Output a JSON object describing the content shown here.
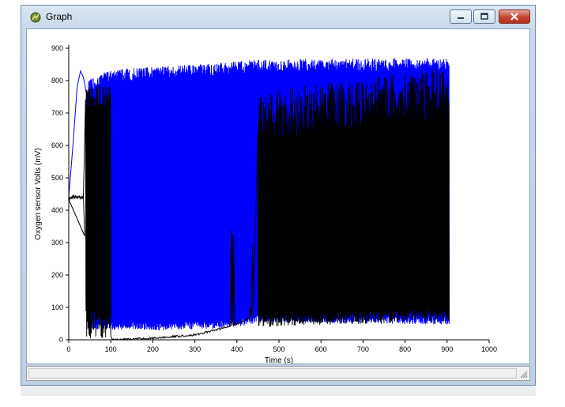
{
  "window": {
    "title": "Graph",
    "icon": "graph-app-icon",
    "controls": [
      "minimize-icon",
      "maximize-icon",
      "close-icon"
    ]
  },
  "chart_data": {
    "type": "line",
    "title": "",
    "xlabel": "Time (s)",
    "ylabel": "Oxygen sensor Volts (mV)",
    "xlim": [
      0,
      1000
    ],
    "ylim": [
      0,
      900
    ],
    "x_ticks": [
      0,
      100,
      200,
      300,
      400,
      500,
      600,
      700,
      800,
      900,
      1000
    ],
    "y_ticks": [
      0,
      100,
      200,
      300,
      400,
      500,
      600,
      700,
      800,
      900
    ],
    "grid": false,
    "legend": "none",
    "series": [
      {
        "color": "#0000ff",
        "x_range": [
          0,
          905
        ],
        "warmup": [
          [
            0,
            440
          ],
          [
            10,
            600
          ],
          [
            20,
            780
          ],
          [
            28,
            830
          ],
          [
            35,
            810
          ],
          [
            42,
            760
          ]
        ],
        "oscillation_upper": [
          [
            45,
            780
          ],
          [
            100,
            815
          ],
          [
            300,
            830
          ],
          [
            450,
            845
          ],
          [
            905,
            850
          ]
        ],
        "oscillation_lower": [
          [
            45,
            40
          ],
          [
            200,
            35
          ],
          [
            400,
            45
          ],
          [
            450,
            60
          ],
          [
            905,
            55
          ]
        ]
      },
      {
        "color": "#000000",
        "x_range": [
          0,
          905
        ],
        "initial_level": [
          [
            0,
            440
          ],
          [
            35,
            440
          ],
          [
            38,
            320
          ]
        ],
        "early_bursts": [
          [
            40,
            90
          ],
          [
            100,
            760
          ]
        ],
        "low_level": [
          [
            100,
            10
          ],
          [
            105,
            0
          ],
          [
            200,
            5
          ],
          [
            300,
            15
          ],
          [
            380,
            40
          ],
          [
            440,
            70
          ]
        ],
        "oscillation_upper": [
          [
            450,
            700
          ],
          [
            905,
            780
          ]
        ],
        "oscillation_lower": [
          [
            450,
            50
          ],
          [
            905,
            70
          ]
        ]
      }
    ]
  }
}
